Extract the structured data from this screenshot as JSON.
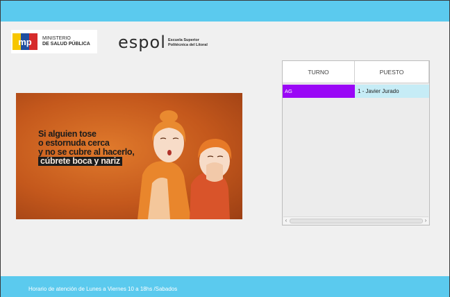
{
  "logos": {
    "msp": {
      "line1": "MINISTERIO",
      "line2": "DE SALUD PÚBLICA",
      "mark": "MSP"
    },
    "espol": {
      "word": "espol",
      "sub1": "Escuela Superior",
      "sub2": "Politécnica del Litoral"
    }
  },
  "banner": {
    "line1": "Si alguien tose",
    "line2": "o estornuda cerca",
    "line3": "y no se cubre al hacerlo,",
    "highlight": "cúbrete boca y nariz"
  },
  "queue": {
    "headers": {
      "turno": "TURNO",
      "puesto": "PUESTO"
    },
    "rows": [
      {
        "turno": "AG",
        "puesto": "1 - Javier Jurado"
      }
    ],
    "scroll_left": "‹",
    "scroll_right": "›"
  },
  "footer": {
    "text": "Horario de atención de Lunes a Viernes 10 a 18hs /Sabados"
  },
  "colors": {
    "bar": "#5bcaee",
    "turno_highlight": "#9a07f6",
    "puesto_highlight": "#c6ecf6"
  }
}
